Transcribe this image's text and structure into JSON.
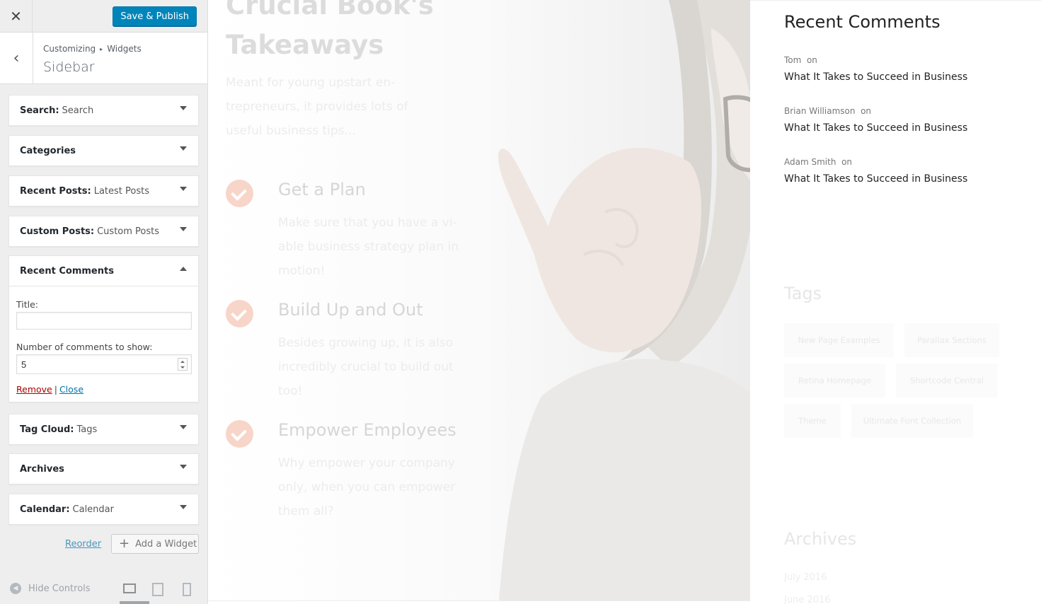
{
  "customizer": {
    "close_icon": "close-icon",
    "save_label": "Save & Publish",
    "breadcrumb": {
      "root": "Customizing",
      "separator": "▸",
      "parent": "Widgets"
    },
    "section_title": "Sidebar",
    "widgets": [
      {
        "name": "Search:",
        "sub": "Search"
      },
      {
        "name": "Categories",
        "sub": ""
      },
      {
        "name": "Recent Posts:",
        "sub": "Latest Posts"
      },
      {
        "name": "Custom Posts:",
        "sub": "Custom Posts"
      },
      {
        "name": "Recent Comments",
        "sub": ""
      },
      {
        "name": "Tag Cloud:",
        "sub": "Tags"
      },
      {
        "name": "Archives",
        "sub": ""
      },
      {
        "name": "Calendar:",
        "sub": "Calendar"
      }
    ],
    "expanded_widget": {
      "title_label": "Title:",
      "title_value": "",
      "number_label": "Number of comments to show:",
      "number_value": "5",
      "remove_label": "Remove",
      "separator": "|",
      "close_label": "Close"
    },
    "reorder_label": "Reorder",
    "add_widget_label": "Add a Widget",
    "hide_controls_label": "Hide Controls",
    "device_preview": [
      "desktop-icon",
      "tablet-icon",
      "mobile-icon"
    ],
    "active_device": "desktop"
  },
  "preview": {
    "heading_line1": "Crucial Book's",
    "heading_line2": "Takeaways",
    "intro": "Meant for young upstart en-trepreneurs, it provides lots of useful business tips...",
    "features": [
      {
        "title": "Get a Plan",
        "text": "Make sure that you have a vi-able business strategy plan in motion!"
      },
      {
        "title": "Build Up and Out",
        "text": "Besides growing up, it is also incredibly crucial to build out too!"
      },
      {
        "title": "Empower Employees",
        "text": "Why empower your company only, when you can empower them all?"
      }
    ],
    "recent_comments": {
      "title": "Recent Comments",
      "items": [
        {
          "author": "Tom",
          "on": "on",
          "post": "What It Takes to Succeed in Business"
        },
        {
          "author": "Brian Williamson",
          "on": "on",
          "post": "What It Takes to Succeed in Business"
        },
        {
          "author": "Adam Smith",
          "on": "on",
          "post": "What It Takes to Succeed in Business"
        }
      ]
    },
    "tags": {
      "title": "Tags",
      "items": [
        "New Page Examples",
        "Parallax Sections",
        "Retina Homepage",
        "Shortcode Central",
        "Theme",
        "Ultimate Font Collection"
      ]
    },
    "archives": {
      "title": "Archives",
      "items": [
        "July 2016",
        "June 2016"
      ]
    }
  },
  "colors": {
    "primary_button": "#0085ba",
    "remove_link": "#aa0000",
    "link": "#0073aa",
    "accent_check": "#f7d5c8"
  }
}
